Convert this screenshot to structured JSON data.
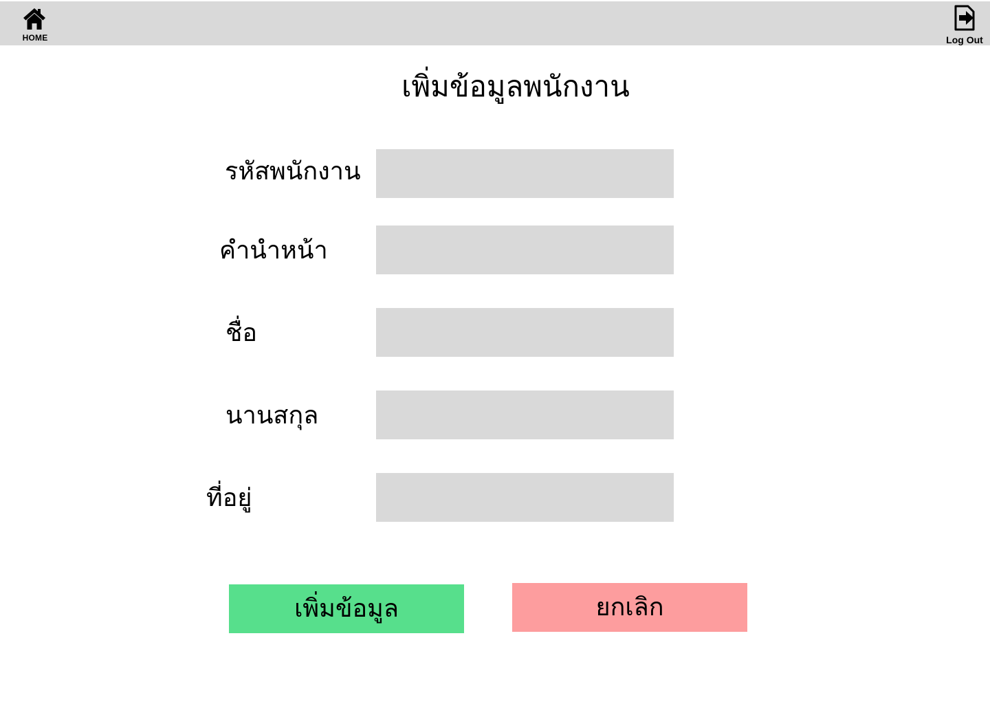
{
  "header": {
    "home_label": "HOME",
    "home_icon": "home-icon",
    "logout_label": "Log Out",
    "logout_icon": "logout-icon",
    "bar_color": "#d9d9d9"
  },
  "page": {
    "title": "เพิ่มข้อมูลพนักงาน"
  },
  "form": {
    "fields": [
      {
        "label": "รหัสพนักงาน",
        "value": "",
        "placeholder": ""
      },
      {
        "label": "คำนำหน้า",
        "value": "",
        "placeholder": ""
      },
      {
        "label": "ชื่อ",
        "value": "",
        "placeholder": ""
      },
      {
        "label": "นานสกุล",
        "value": "",
        "placeholder": ""
      },
      {
        "label": "ที่อยู่",
        "value": "",
        "placeholder": ""
      }
    ],
    "input_color": "#d9d9d9"
  },
  "actions": {
    "submit_label": "เพิ่มข้อมูล",
    "submit_color": "#57df8c",
    "cancel_label": "ยกเลิก",
    "cancel_color": "#fd9d9e"
  }
}
